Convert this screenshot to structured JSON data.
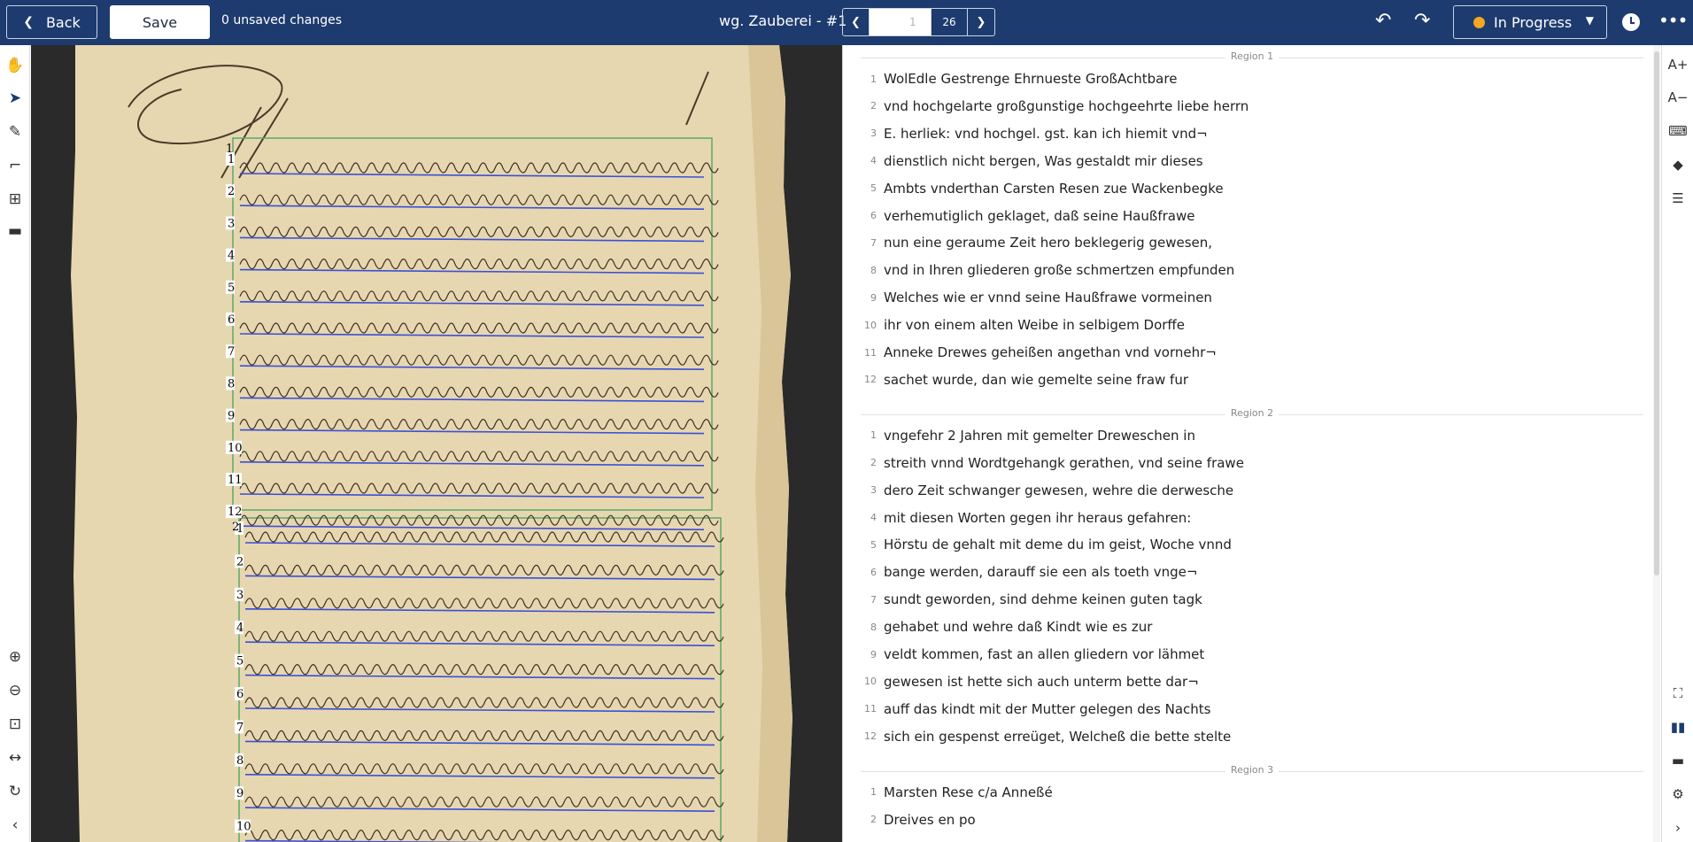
{
  "topbar": {
    "back_label": "Back",
    "save_label": "Save",
    "unsaved_text": "0 unsaved changes",
    "doc_title": "wg. Zauberei - #1",
    "page_input_placeholder": "1",
    "page_total": "26",
    "status_label": "In Progress",
    "status_color": "#f5a623",
    "icons": {
      "back": "chevron-left-icon",
      "prev_page": "chevron-left-icon",
      "next_page": "chevron-right-icon",
      "undo": "undo-icon",
      "redo": "redo-icon",
      "status_caret": "chevron-down-icon",
      "history": "history-icon",
      "more": "more-horizontal-icon"
    }
  },
  "left_toolbar": {
    "tools": [
      "hand-icon",
      "pointer-icon",
      "pen-icon",
      "crop-icon",
      "layout-icon",
      "ruler-icon"
    ],
    "active_tool": "pointer-icon",
    "view_tools": [
      "zoom-in-icon",
      "zoom-out-icon",
      "fit-icon",
      "fit-width-icon",
      "rotate-icon",
      "collapse-left-icon"
    ]
  },
  "image_area": {
    "region_labels": [
      "1",
      "2"
    ],
    "line_numbers_region1": [
      "1",
      "2",
      "3",
      "4",
      "5",
      "6",
      "7",
      "8",
      "9",
      "10",
      "11",
      "12"
    ],
    "line_numbers_region2": [
      "1",
      "2",
      "3",
      "4",
      "5",
      "6",
      "7",
      "8",
      "9",
      "10"
    ],
    "region_box_color": "#5aa86a",
    "baseline_color": "#3b4fd8"
  },
  "transcript": {
    "regions": [
      {
        "label": "Region 1",
        "lines": [
          {
            "n": "1",
            "text": "WolEdle Gestrenge Ehrnueste GroßAchtbare"
          },
          {
            "n": "2",
            "text": "vnd hochgelarte großgunstige hochgeehrte liebe herrn"
          },
          {
            "n": "3",
            "text": "E. herliek: vnd hochgel. gst. kan ich hiemit vnd¬"
          },
          {
            "n": "4",
            "text": "dienstlich nicht bergen, Was gestaldt mir dieses"
          },
          {
            "n": "5",
            "text": "Ambts vnderthan Carsten Resen zue Wackenbegke"
          },
          {
            "n": "6",
            "text": "verhemutiglich geklaget, daß seine Haußfrawe"
          },
          {
            "n": "7",
            "text": "nun eine geraume Zeit hero beklegerig gewesen,"
          },
          {
            "n": "8",
            "text": "vnd in Ihren gliederen große schmertzen empfunden"
          },
          {
            "n": "9",
            "text": "Welches wie er vnnd seine Haußfrawe vormeinen"
          },
          {
            "n": "10",
            "text": "ihr von einem alten Weibe in selbigem Dorffe"
          },
          {
            "n": "11",
            "text": "Anneke Drewes geheißen angethan vnd vornehr¬"
          },
          {
            "n": "12",
            "text": "sachet wurde, dan wie gemelte seine fraw fur"
          }
        ]
      },
      {
        "label": "Region 2",
        "lines": [
          {
            "n": "1",
            "text": "vngefehr 2 Jahren mit gemelter Dreweschen in"
          },
          {
            "n": "2",
            "text": "streith vnnd Wordtgehangk gerathen, vnd seine frawe"
          },
          {
            "n": "3",
            "text": "dero Zeit schwanger gewesen, wehre die derwesche"
          },
          {
            "n": "4",
            "text": "mit diesen Worten gegen ihr heraus gefahren:"
          },
          {
            "n": "5",
            "text": "Hörstu de gehalt mit deme du im geist, Woche vnnd"
          },
          {
            "n": "6",
            "text": "bange werden, darauff sie een als toeth vnge¬"
          },
          {
            "n": "7",
            "text": "sundt geworden, sind dehme keinen guten tagk"
          },
          {
            "n": "8",
            "text": "gehabet und wehre daß Kindt wie es zur"
          },
          {
            "n": "9",
            "text": "veldt kommen, fast an allen gliedern vor lähmet"
          },
          {
            "n": "10",
            "text": "gewesen ist hette sich auch unterm bette dar¬"
          },
          {
            "n": "11",
            "text": "auff das kindt mit der Mutter gelegen des Nachts"
          },
          {
            "n": "12",
            "text": "sich ein gespenst erreüget, Welcheß die bette stelte"
          }
        ]
      },
      {
        "label": "Region 3",
        "lines": [
          {
            "n": "1",
            "text": "Marsten Rese c/a Anneßé"
          },
          {
            "n": "2",
            "text": "Dreives en po"
          }
        ]
      }
    ]
  },
  "right_toolbar": {
    "icons": [
      "font-increase-icon",
      "font-decrease-icon",
      "keyboard-icon",
      "tag-icon",
      "list-icon",
      "fullscreen-icon",
      "columns-icon",
      "rows-icon",
      "settings-icon",
      "collapse-right-icon"
    ],
    "labels": {
      "font_increase": "A+",
      "font_decrease": "A−"
    }
  }
}
